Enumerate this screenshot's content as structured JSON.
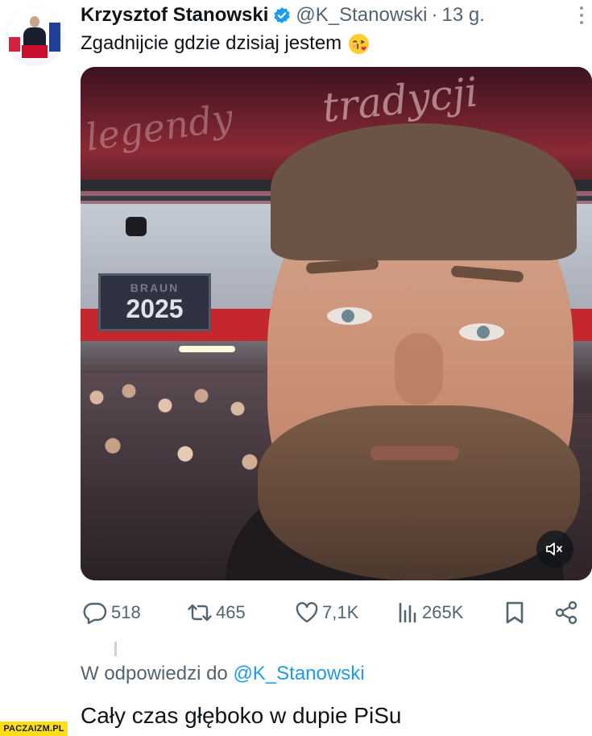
{
  "tweet": {
    "author_name": "Krzysztof Stanowski",
    "verified": true,
    "handle": "@K_Stanowski",
    "separator": "·",
    "time": "13 g.",
    "text": "Zgadnijcie gdzie dzisiaj jestem",
    "emoji": "face-throwing-kiss-icon",
    "media": {
      "ceiling_text_1": "tradycji",
      "ceiling_text_2": "legendy",
      "sign_text_1": "BRAUN",
      "sign_text_2": "2025",
      "muted": true
    },
    "stats": {
      "replies": "518",
      "retweets": "465",
      "likes": "7,1K",
      "views": "265K"
    }
  },
  "reply": {
    "prefix": "W odpowiedzi do",
    "mention": "@K_Stanowski",
    "text": "Cały czas głęboko w dupie PiSu"
  },
  "watermark": "PACZAIZM.PL",
  "colors": {
    "text": "#0f1419",
    "secondary": "#536471",
    "accent": "#1d9bf0",
    "watermark_bg": "#ffde17"
  }
}
